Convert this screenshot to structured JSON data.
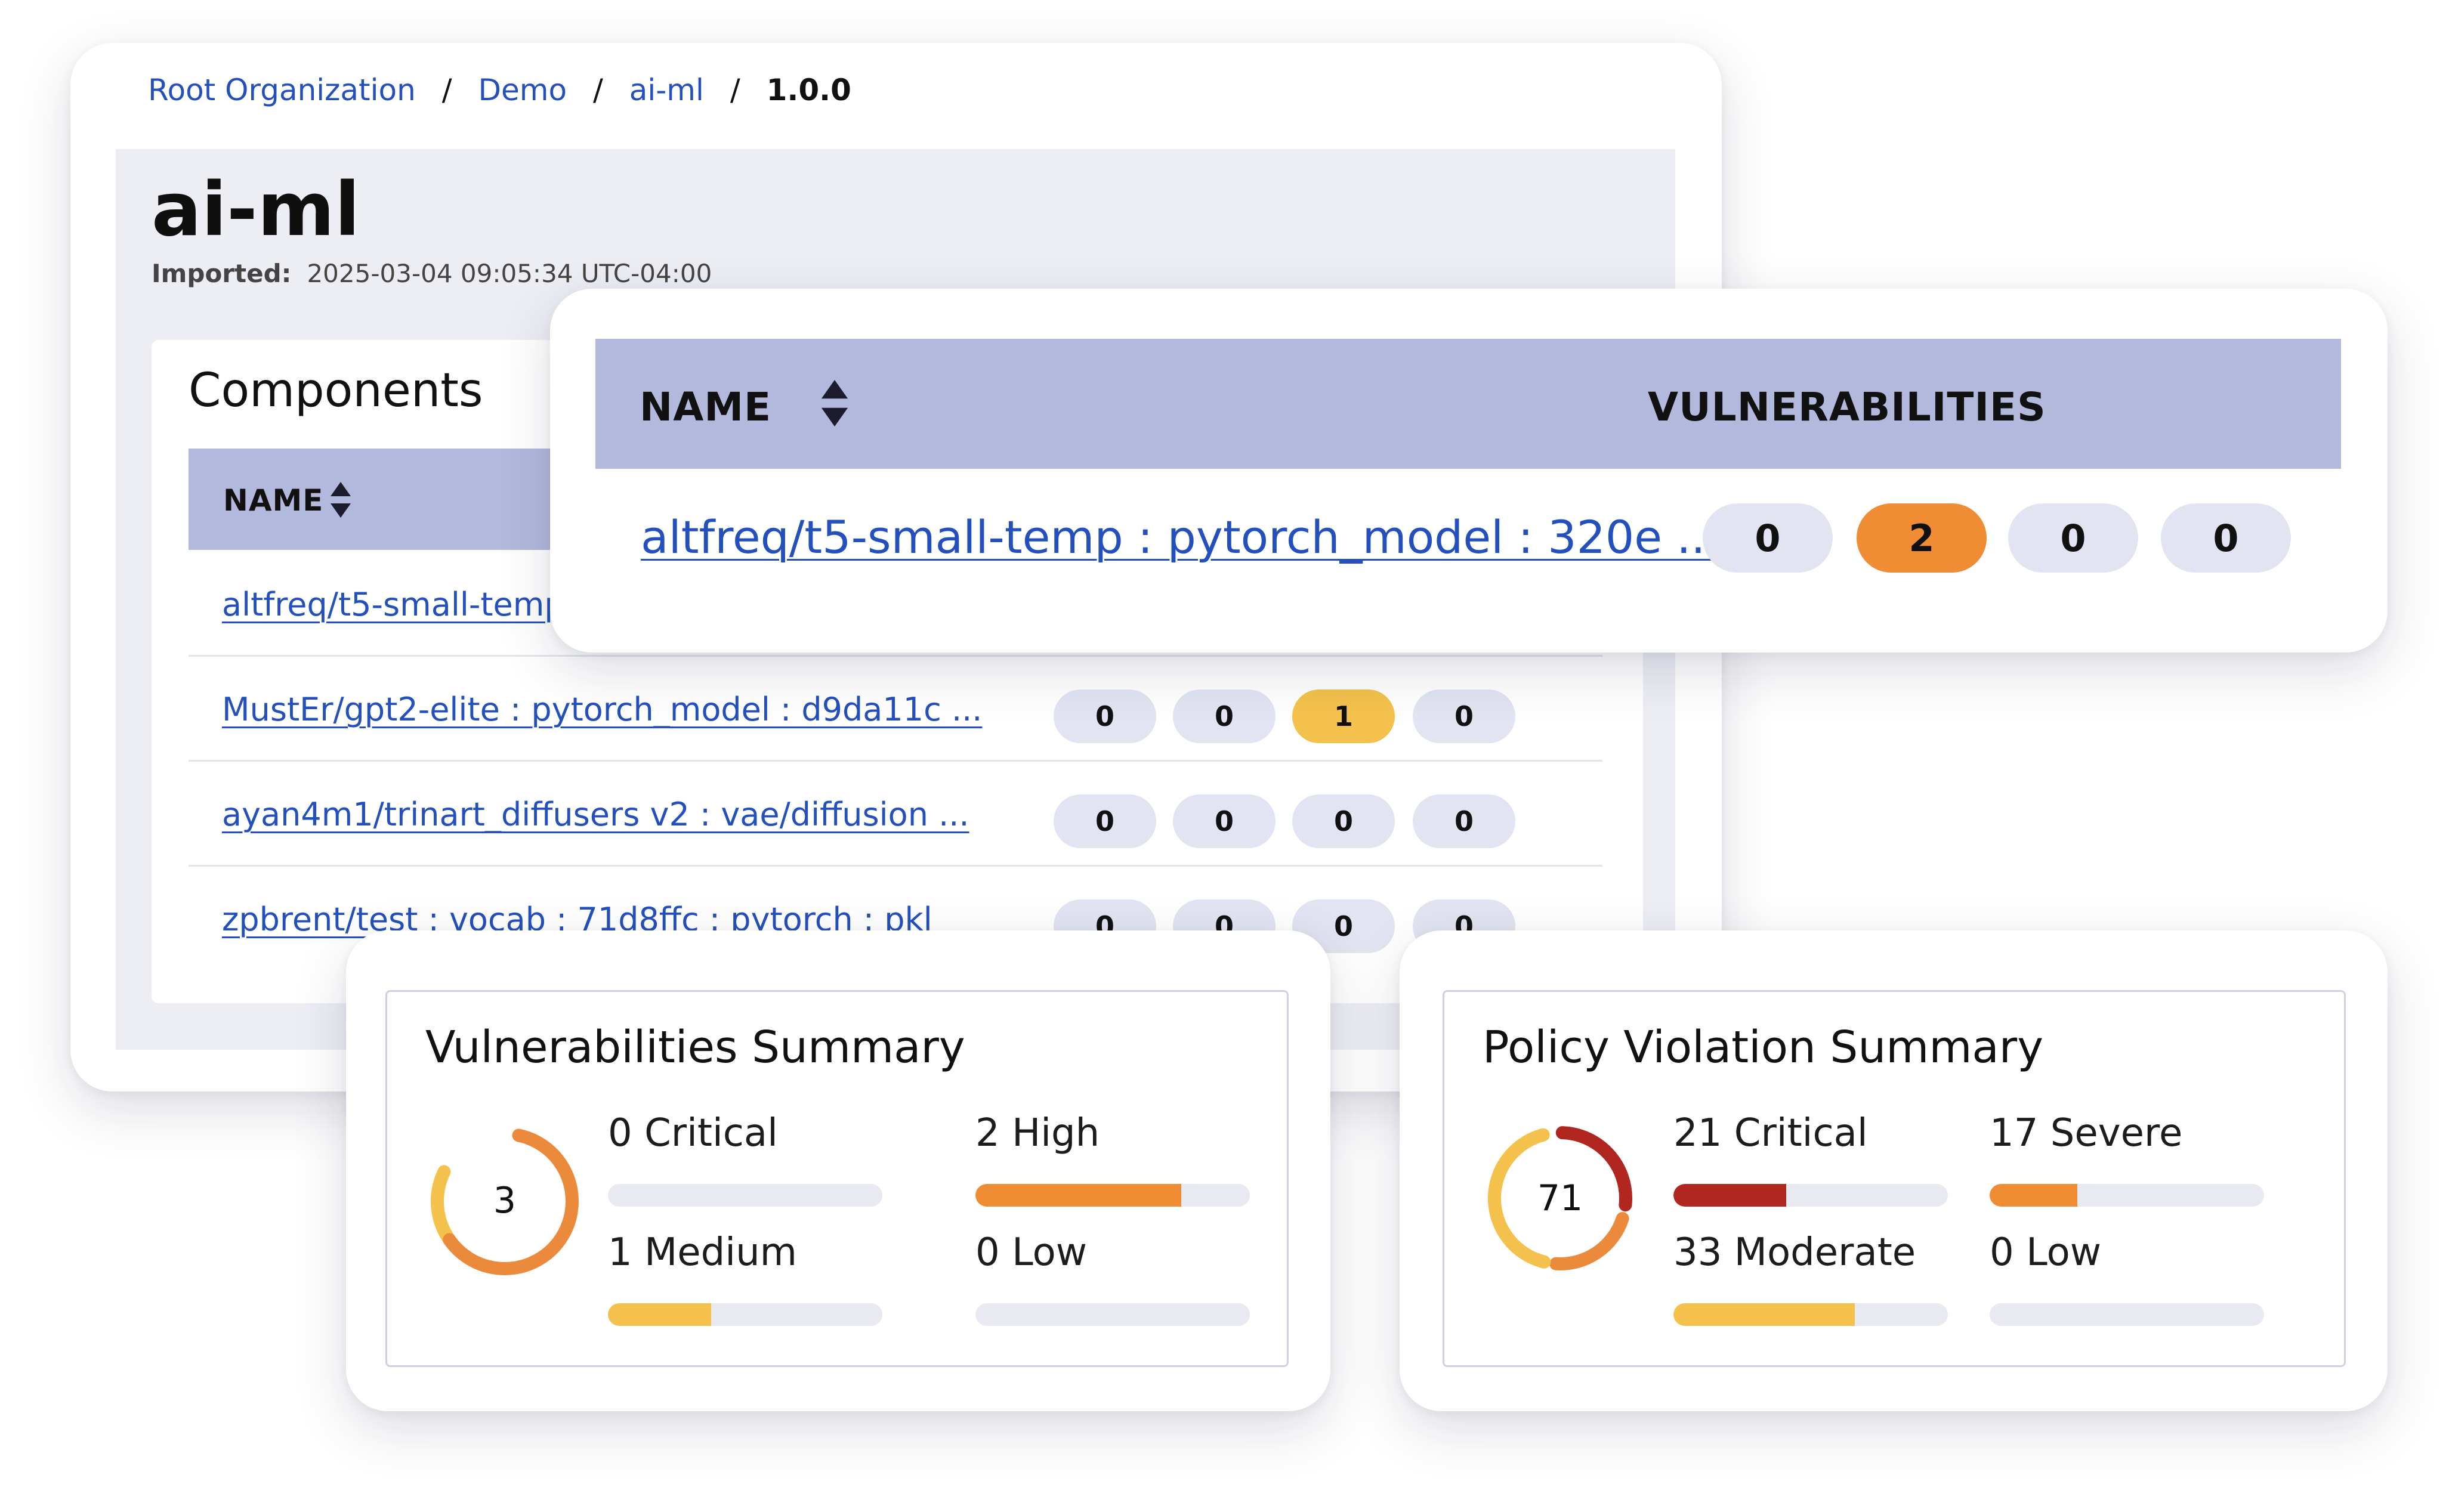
{
  "breadcrumb": {
    "items": [
      "Root Organization",
      "Demo",
      "ai-ml"
    ],
    "current": "1.0.0",
    "separator": "/"
  },
  "project": {
    "title": "ai-ml",
    "imported_label": "Imported:",
    "imported_value": "2025-03-04 09:05:34 UTC-04:00"
  },
  "components": {
    "heading": "Components",
    "name_header": "NAME",
    "rows": [
      {
        "name": "altfreq/t5-small-temp : pytorch_model : 320e ...",
        "counts": [
          "0",
          "2",
          "0",
          "0"
        ]
      },
      {
        "name": "MustEr/gpt2-elite : pytorch_model : d9da11c ...",
        "counts": [
          "0",
          "0",
          "1",
          "0"
        ]
      },
      {
        "name": "ayan4m1/trinart_diffusers v2 : vae/diffusion ...",
        "counts": [
          "0",
          "0",
          "0",
          "0"
        ]
      },
      {
        "name": "zpbrent/test : vocab : 71d8ffc : pytorch : pkl",
        "counts": [
          "0",
          "0",
          "0",
          "0"
        ]
      }
    ]
  },
  "zoom": {
    "name_header": "NAME",
    "vuln_header": "VULNERABILITIES",
    "row_name": "altfreq/t5-small-temp : pytorch_model : 320e ...",
    "counts": [
      "0",
      "2",
      "0",
      "0"
    ]
  },
  "vuln_summary": {
    "title": "Vulnerabilities Summary",
    "total": "3",
    "items": [
      {
        "label": "0 Critical",
        "value": 0
      },
      {
        "label": "2 High",
        "value": 2
      },
      {
        "label": "1 Medium",
        "value": 1
      },
      {
        "label": "0 Low",
        "value": 0
      }
    ]
  },
  "policy_summary": {
    "title": "Policy Violation Summary",
    "total": "71",
    "items": [
      {
        "label": "21 Critical",
        "value": 21
      },
      {
        "label": "17 Severe",
        "value": 17
      },
      {
        "label": "33 Moderate",
        "value": 33
      },
      {
        "label": "0 Low",
        "value": 0
      }
    ]
  },
  "colors": {
    "header_band": "#b3b8dd",
    "pill_neutral": "#e2e4f1",
    "high": "#f08c34",
    "medium": "#f4c24c",
    "critical": "#b1271f",
    "link": "#2450bd"
  }
}
